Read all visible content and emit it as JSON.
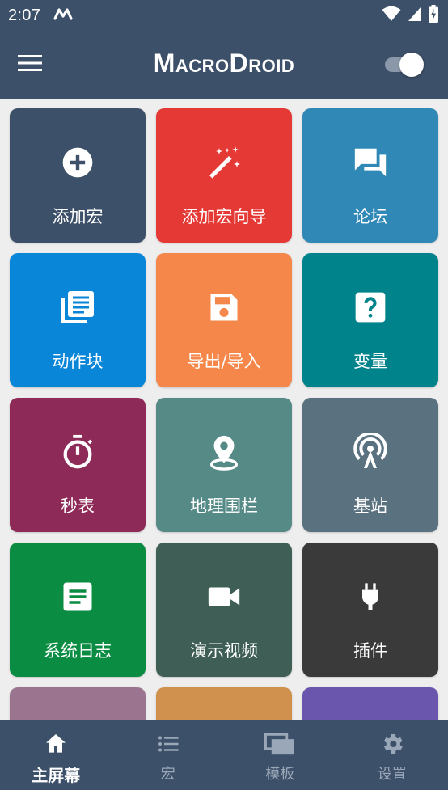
{
  "status_bar": {
    "time": "2:07",
    "notification_icon": "macrodroid-notification-icon",
    "icons": [
      "wifi-icon",
      "cell-signal-icon",
      "battery-charging-icon"
    ]
  },
  "app_bar": {
    "title": "MacroDroid",
    "menu_icon": "hamburger-menu-icon",
    "toggle_state": "on"
  },
  "tiles": [
    {
      "label": "添加宏",
      "icon": "add-circle-icon",
      "color": "#3d5069"
    },
    {
      "label": "添加宏向导",
      "icon": "magic-wand-icon",
      "color": "#e53935"
    },
    {
      "label": "论坛",
      "icon": "forum-icon",
      "color": "#2f88b6"
    },
    {
      "label": "动作块",
      "icon": "action-blocks-icon",
      "color": "#0a86d8"
    },
    {
      "label": "导出/导入",
      "icon": "save-icon",
      "color": "#f5874a"
    },
    {
      "label": "变量",
      "icon": "help-box-icon",
      "color": "#00838b"
    },
    {
      "label": "秒表",
      "icon": "stopwatch-icon",
      "color": "#8e2a57"
    },
    {
      "label": "地理围栏",
      "icon": "location-pin-icon",
      "color": "#568a87"
    },
    {
      "label": "基站",
      "icon": "cell-tower-icon",
      "color": "#5a7180"
    },
    {
      "label": "系统日志",
      "icon": "log-document-icon",
      "color": "#0a8c42"
    },
    {
      "label": "演示视频",
      "icon": "video-camera-icon",
      "color": "#3f5f56"
    },
    {
      "label": "插件",
      "icon": "plug-icon",
      "color": "#3a3a3a"
    },
    {
      "label": "",
      "icon": "",
      "color": "#9b7590"
    },
    {
      "label": "",
      "icon": "",
      "color": "#d0914f"
    },
    {
      "label": "",
      "icon": "",
      "color": "#6a57ad"
    }
  ],
  "bottom_nav": [
    {
      "label": "主屏幕",
      "icon": "home-icon",
      "active": true
    },
    {
      "label": "宏",
      "icon": "list-icon",
      "active": false
    },
    {
      "label": "模板",
      "icon": "templates-icon",
      "active": false
    },
    {
      "label": "设置",
      "icon": "settings-gear-icon",
      "active": false
    }
  ],
  "colors": {
    "bar_background": "#3d5069",
    "page_background": "#eeeeee",
    "nav_inactive": "#9aa7b8"
  }
}
